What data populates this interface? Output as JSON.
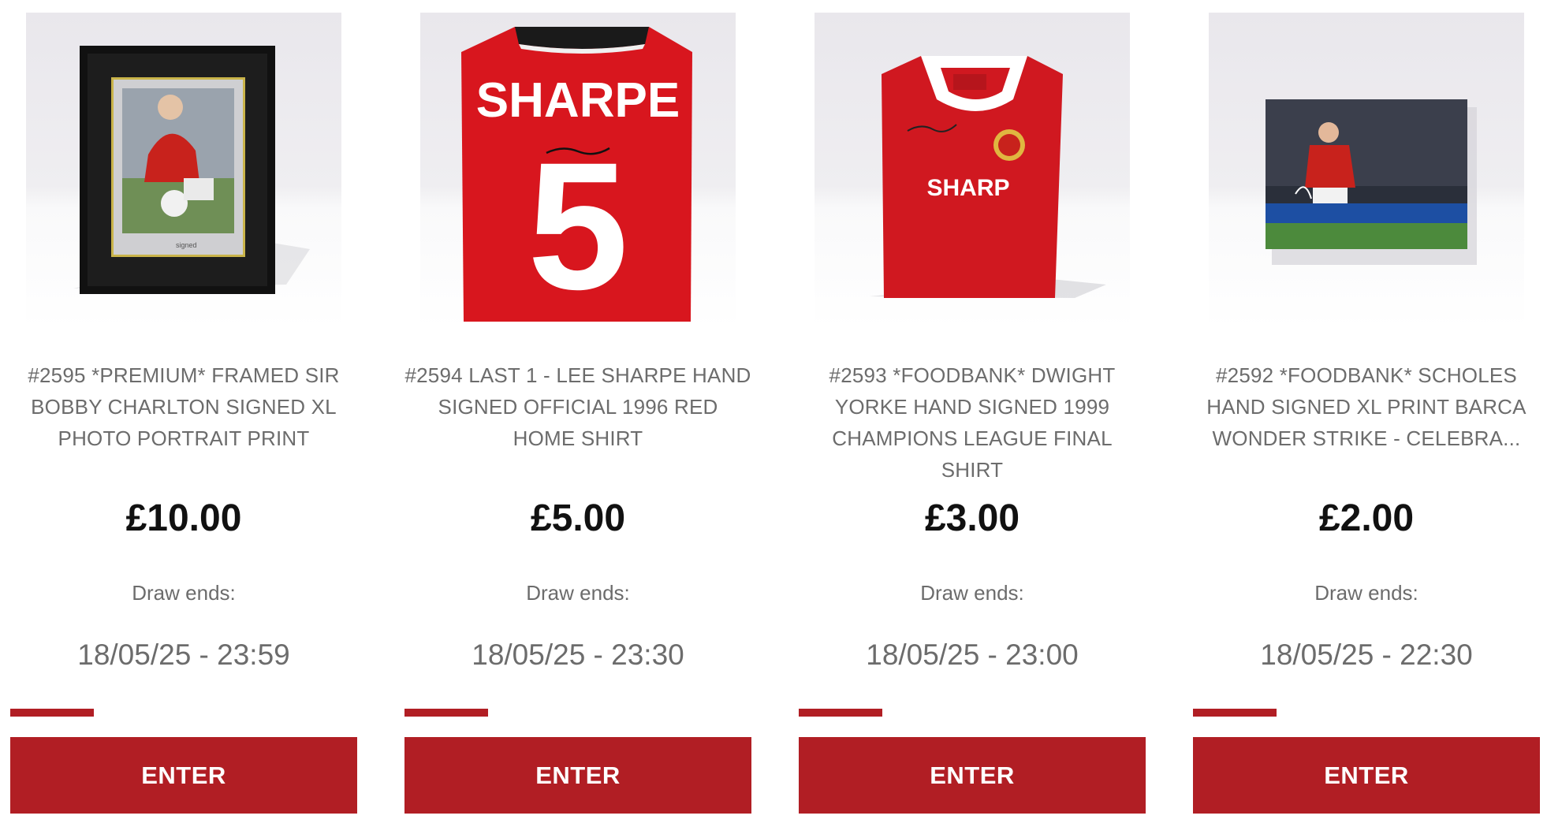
{
  "theme": {
    "accent": "#b11e24",
    "text_muted": "#6c6c6c",
    "price_color": "#111111"
  },
  "competitions": [
    {
      "title": "#2595 *PREMIUM* FRAMED SIR BOBBY CHARLTON SIGNED XL PHOTO PORTRAIT PRINT",
      "price": "£10.00",
      "draw_label": "Draw ends:",
      "draw_date": "18/05/25 - 23:59",
      "progress": 0.24,
      "button_label": "ENTER",
      "image_icon": "framed-photo-icon"
    },
    {
      "title": "#2594 LAST 1 - LEE SHARPE HAND SIGNED OFFICIAL 1996 RED HOME SHIRT",
      "price": "£5.00",
      "draw_label": "Draw ends:",
      "draw_date": "18/05/25 - 23:30",
      "progress": 0.24,
      "button_label": "ENTER",
      "image_icon": "shirt-back-icon",
      "shirt_name": "SHARPE",
      "shirt_number": "5"
    },
    {
      "title": "#2593 *FOODBANK* DWIGHT YORKE HAND SIGNED 1999 CHAMPIONS LEAGUE FINAL SHIRT",
      "price": "£3.00",
      "draw_label": "Draw ends:",
      "draw_date": "18/05/25 - 23:00",
      "progress": 0.24,
      "button_label": "ENTER",
      "image_icon": "shirt-front-icon",
      "shirt_sponsor": "SHARP"
    },
    {
      "title": "#2592 *FOODBANK* SCHOLES HAND SIGNED XL PRINT BARCA WONDER STRIKE - CELEBRA...",
      "price": "£2.00",
      "draw_label": "Draw ends:",
      "draw_date": "18/05/25 - 22:30",
      "progress": 0.24,
      "button_label": "ENTER",
      "image_icon": "photo-print-icon"
    }
  ]
}
